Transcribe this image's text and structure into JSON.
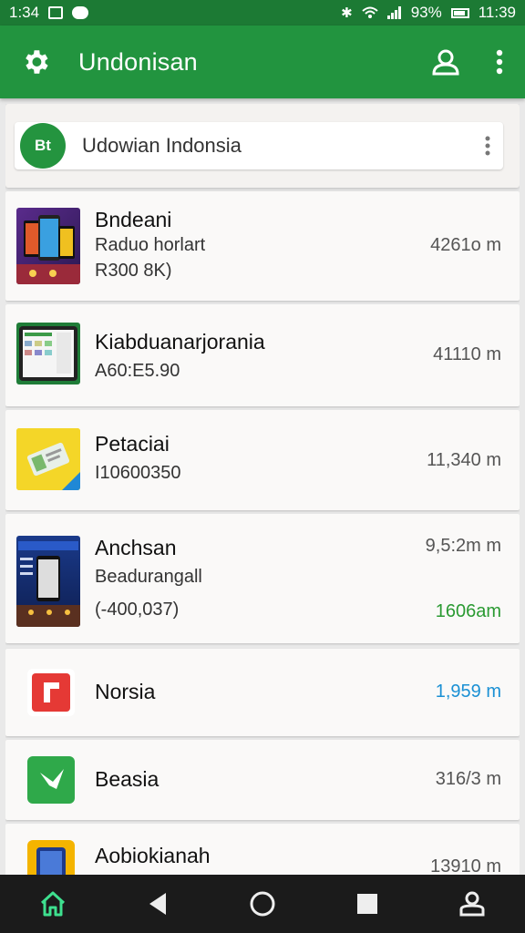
{
  "status_bar": {
    "time_left": "1:34",
    "battery_percent": "93%",
    "clock": "11:39"
  },
  "app_bar": {
    "title": "Undonisan",
    "settings_icon": "gear-icon",
    "account_icon": "person-icon",
    "more_icon": "more-vert-icon"
  },
  "search": {
    "badge": "Bt",
    "text": "Udowian Indonsia",
    "more_icon": "more-vert-icon"
  },
  "items": [
    {
      "name": "Bndeani",
      "line1": "Raduo horlart",
      "line2": "R300 8K)",
      "distance": "4261o m"
    },
    {
      "name": "Kiabduanarjorania",
      "line1": "A60:E5.90",
      "distance": "41110 m"
    },
    {
      "name": "Petaciai",
      "line1": "I10600350",
      "distance": "11,340 m"
    },
    {
      "name": "Anchsan",
      "line1": "Beadurangall",
      "line2": "(-400,037)",
      "distance": "9,5:2m m",
      "distance2": "1606am"
    },
    {
      "name": "Norsia",
      "distance": "1,959 m"
    },
    {
      "name": "Beasia",
      "distance": "316/3 m"
    },
    {
      "name": "Aobiokianah",
      "distance": "13910 m"
    }
  ],
  "colors": {
    "status_bar": "#1c7a34",
    "app_bar": "#22943f",
    "accent_green": "#2a9a32",
    "accent_blue": "#1a90d4",
    "nav_bar": "#1b1b1b"
  },
  "nav": {
    "home_icon": "home-icon",
    "back_icon": "back-icon",
    "circle_icon": "circle-home-icon",
    "recents_icon": "recents-icon",
    "profile_icon": "person-icon"
  }
}
